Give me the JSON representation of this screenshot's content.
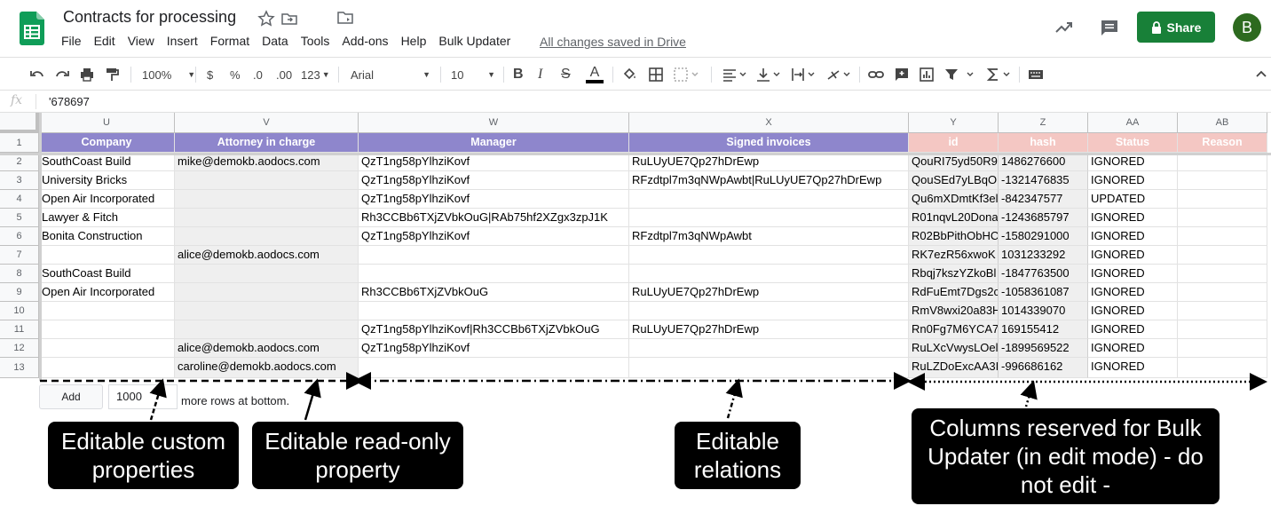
{
  "header": {
    "title": "Contracts for processing",
    "saved_status": "All changes saved in Drive",
    "share_label": "Share",
    "avatar_initial": "B",
    "menu": [
      "File",
      "Edit",
      "View",
      "Insert",
      "Format",
      "Data",
      "Tools",
      "Add-ons",
      "Help",
      "Bulk Updater"
    ]
  },
  "toolbar": {
    "zoom": "100%",
    "currency": "$",
    "percent": "%",
    "decrease_decimal": ".0",
    "increase_decimal": ".00",
    "number_format": "123",
    "font": "Arial",
    "font_size": "10"
  },
  "formula_bar": {
    "fx": "fx",
    "value": "'678697"
  },
  "grid": {
    "columns": [
      "U",
      "V",
      "W",
      "X",
      "Y",
      "Z",
      "AA",
      "AB"
    ],
    "headers": [
      "Company",
      "Attorney in charge",
      "Manager",
      "Signed invoices",
      "id",
      "hash",
      "Status",
      "Reason"
    ],
    "rows": [
      {
        "n": "1"
      },
      {
        "n": "2",
        "cells": [
          "SouthCoast Build",
          "mike@demokb.aodocs.com",
          "QzT1ng58pYlhziKovf",
          "RuLUyUE7Qp27hDrEwp",
          "QouRI75yd50R9",
          "1486276600",
          "IGNORED",
          ""
        ]
      },
      {
        "n": "3",
        "cells": [
          "University Bricks",
          "",
          "QzT1ng58pYlhziKovf",
          "RFzdtpl7m3qNWpAwbt|RuLUyUE7Qp27hDrEwp",
          "QouSEd7yLBqO",
          "-1321476835",
          "IGNORED",
          ""
        ]
      },
      {
        "n": "4",
        "cells": [
          "Open Air Incorporated",
          "",
          "QzT1ng58pYlhziKovf",
          "",
          "Qu6mXDmtKf3el",
          "-842347577",
          "UPDATED",
          ""
        ]
      },
      {
        "n": "5",
        "cells": [
          "Lawyer & Fitch",
          "",
          "Rh3CCBb6TXjZVbkOuG|RAb75hf2XZgx3zpJ1K",
          "",
          "R01nqvL20Dona",
          "-1243685797",
          "IGNORED",
          ""
        ]
      },
      {
        "n": "6",
        "cells": [
          "Bonita Construction",
          "",
          "QzT1ng58pYlhziKovf",
          "RFzdtpl7m3qNWpAwbt",
          "R02BbPithObHC",
          "-1580291000",
          "IGNORED",
          ""
        ]
      },
      {
        "n": "7",
        "cells": [
          "",
          "alice@demokb.aodocs.com",
          "",
          "",
          "RK7ezR56xwoK",
          "1031233292",
          "IGNORED",
          ""
        ]
      },
      {
        "n": "8",
        "cells": [
          "SouthCoast Build",
          "",
          "",
          "",
          "Rbqj7kszYZkoBl",
          "-1847763500",
          "IGNORED",
          ""
        ]
      },
      {
        "n": "9",
        "cells": [
          "Open Air Incorporated",
          "",
          "Rh3CCBb6TXjZVbkOuG",
          "RuLUyUE7Qp27hDrEwp",
          "RdFuEmt7Dgs2c",
          "-1058361087",
          "IGNORED",
          ""
        ]
      },
      {
        "n": "10",
        "cells": [
          "",
          "",
          "",
          "",
          "RmV8wxi20a83H",
          "1014339070",
          "IGNORED",
          ""
        ]
      },
      {
        "n": "11",
        "cells": [
          "",
          "",
          "QzT1ng58pYlhziKovf|Rh3CCBb6TXjZVbkOuG",
          "RuLUyUE7Qp27hDrEwp",
          "Rn0Fg7M6YCA7",
          "169155412",
          "IGNORED",
          ""
        ]
      },
      {
        "n": "12",
        "cells": [
          "",
          "alice@demokb.aodocs.com",
          "QzT1ng58pYlhziKovf",
          "",
          "RuLXcVwysLOel",
          "-1899569522",
          "IGNORED",
          ""
        ]
      },
      {
        "n": "13",
        "cells": [
          "",
          "caroline@demokb.aodocs.com",
          "",
          "",
          "RuLZDoExcAA3I",
          "-996686162",
          "IGNORED",
          ""
        ]
      }
    ]
  },
  "bottom": {
    "add_label": "Add",
    "rows_value": "1000",
    "more_rows_text": "more rows at bottom."
  },
  "callouts": {
    "custom": "Editable custom properties",
    "readonly": "Editable read-only property",
    "relations": "Editable relations",
    "reserved": "Columns reserved for Bulk Updater (in edit mode) - do not edit -"
  },
  "colors": {
    "header_purple": "#8e86cc",
    "header_pink": "#f4c7c3",
    "readonly_gray": "#efefef",
    "share_green": "#188038"
  }
}
